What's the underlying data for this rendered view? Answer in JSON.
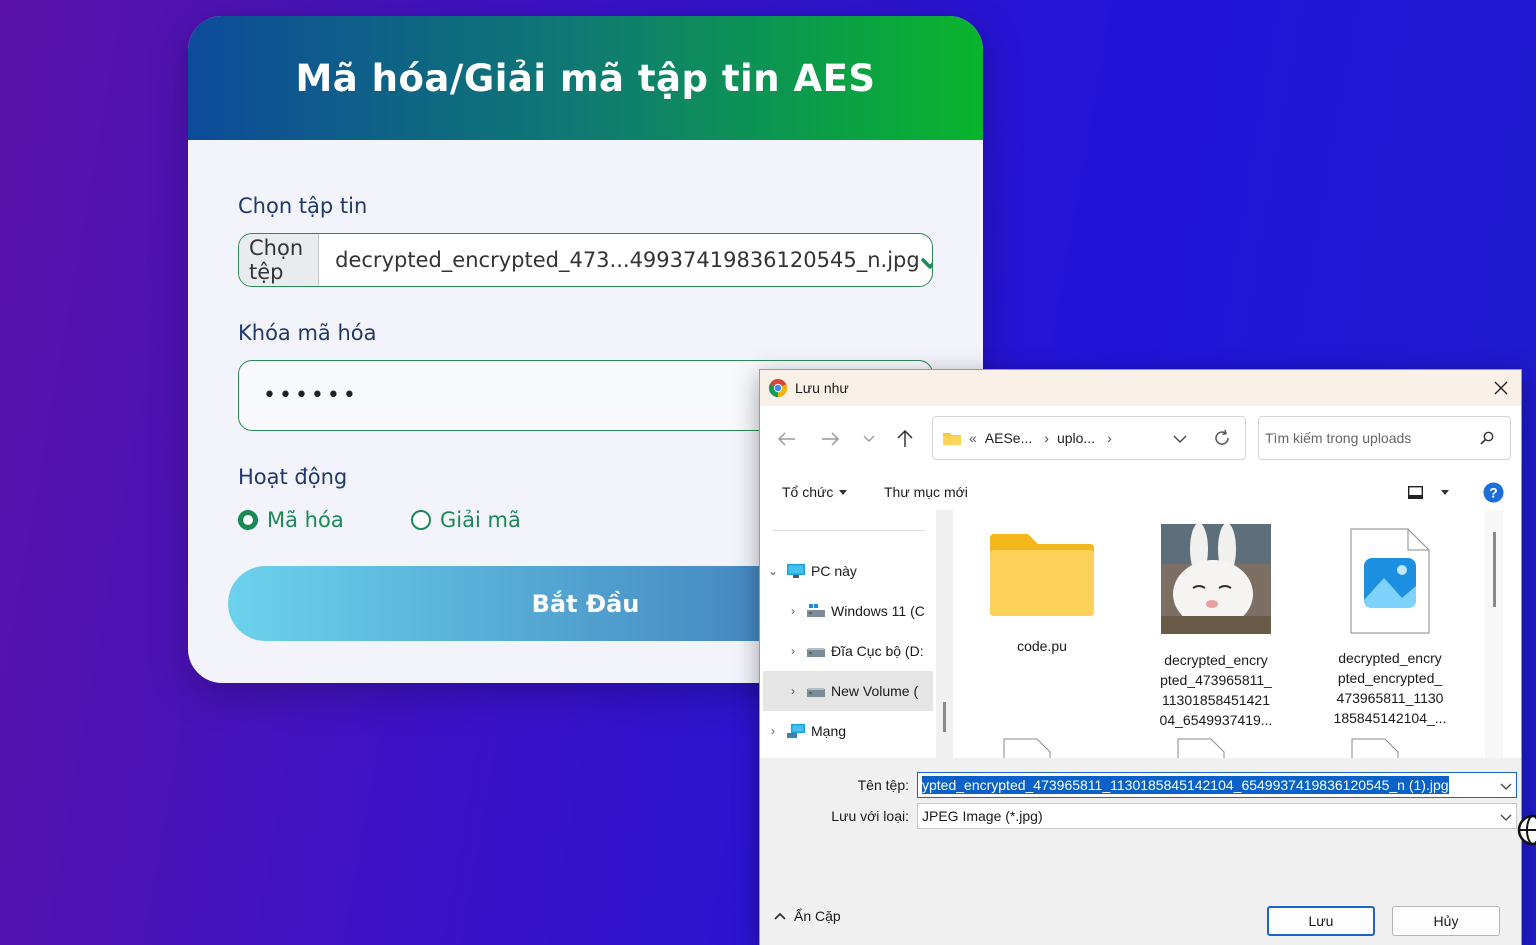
{
  "app": {
    "title": "Mã hóa/Giải mã tập tin AES",
    "file_label": "Chọn tập tin",
    "file_button": "Chọn tệp",
    "file_name": "decrypted_encrypted_473...49937419836120545_n.jpg",
    "key_label": "Khóa mã hóa",
    "key_value": "••••••",
    "mode_label": "Hoạt động",
    "mode_encrypt": "Mã hóa",
    "mode_decrypt": "Giải mã",
    "start_button": "Bắt Đầu",
    "selected_mode": "encrypt",
    "colors": {
      "accent_green": "#1a8a55",
      "header_start": "#0d4b9a",
      "header_end": "#09b52c"
    }
  },
  "dialog": {
    "title": "Lưu như",
    "address": {
      "prefix": "«",
      "segments": [
        "AESe...",
        "uplo..."
      ]
    },
    "search_placeholder": "Tìm kiếm trong uploads",
    "toolbar": {
      "organize": "Tổ chức",
      "new_folder": "Thư mục mới"
    },
    "nav_items": [
      {
        "label": "PC này",
        "icon": "monitor-icon",
        "level": 0,
        "expanded": true
      },
      {
        "label": "Windows 11 (C",
        "icon": "drive-icon",
        "level": 1
      },
      {
        "label": "Đĩa Cục bộ (D:",
        "icon": "drive-icon",
        "level": 1
      },
      {
        "label": "New Volume (",
        "icon": "drive-icon",
        "level": 1,
        "selected": true
      },
      {
        "label": "Mạng",
        "icon": "network-icon",
        "level": 0
      }
    ],
    "files": [
      {
        "name": "code.pu",
        "type": "folder"
      },
      {
        "name": "decrypted_encry pted_473965811_ 11301858451421 04_6549937419...",
        "type": "image"
      },
      {
        "name": "decrypted_encry pted_encrypted_ 473965811_1130 185845142104_...",
        "type": "photo-file"
      }
    ],
    "filename_label": "Tên tệp:",
    "filename_value": "ypted_encrypted_473965811_1130185845142104_6549937419836120545_n (1).jpg",
    "type_label": "Lưu với loại:",
    "type_value": "JPEG Image (*.jpg)",
    "hide_folders": "Ẩn Cặp",
    "save_button": "Lưu",
    "cancel_button": "Hủy"
  }
}
